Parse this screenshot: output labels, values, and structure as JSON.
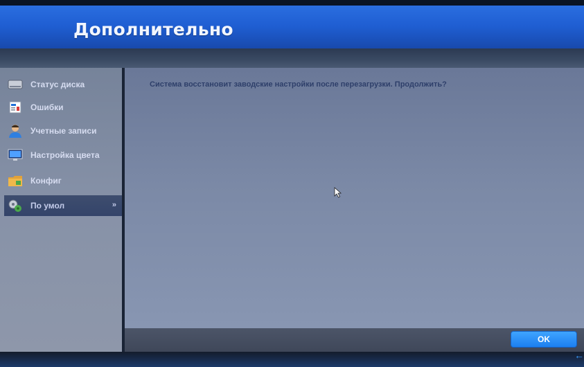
{
  "header": {
    "title": "Дополнительно"
  },
  "sidebar": {
    "items": [
      {
        "label": "Статус диска",
        "icon": "hard-disk-icon"
      },
      {
        "label": "Ошибки",
        "icon": "error-log-icon"
      },
      {
        "label": "Учетные записи",
        "icon": "user-account-icon"
      },
      {
        "label": "Настройка цвета",
        "icon": "monitor-color-icon"
      },
      {
        "label": "Конфиг",
        "icon": "folder-config-icon"
      },
      {
        "label": "По умол",
        "icon": "default-gears-icon",
        "active": true,
        "chevron": "»"
      }
    ]
  },
  "main": {
    "message": "Система восстановит заводские настройки после перезагрузки. Продолжить?"
  },
  "footer": {
    "ok_label": "OK",
    "back_glyph": "←"
  },
  "colors": {
    "header_blue": "#1f5ed2",
    "ok_blue": "#1c7ff0",
    "active_item": "#34446a"
  }
}
